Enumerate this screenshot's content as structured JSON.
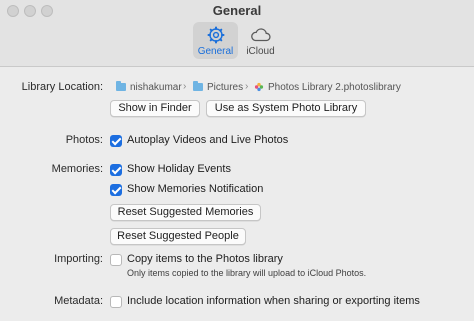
{
  "window": {
    "title": "General"
  },
  "tabs": [
    {
      "label": "General",
      "icon": "gear-icon",
      "selected": true
    },
    {
      "label": "iCloud",
      "icon": "cloud-icon",
      "selected": false
    }
  ],
  "library": {
    "label": "Library Location:",
    "path": [
      "nishakumar",
      "Pictures",
      "Photos Library 2.photoslibrary"
    ],
    "show_in_finder": "Show in Finder",
    "use_as_system": "Use as System Photo Library"
  },
  "photos": {
    "label": "Photos:",
    "autoplay": {
      "text": "Autoplay Videos and Live Photos",
      "checked": true
    }
  },
  "memories": {
    "label": "Memories:",
    "holiday": {
      "text": "Show Holiday Events",
      "checked": true
    },
    "notification": {
      "text": "Show Memories Notification",
      "checked": true
    },
    "reset_memories": "Reset Suggested Memories",
    "reset_people": "Reset Suggested People"
  },
  "importing": {
    "label": "Importing:",
    "copy": {
      "text": "Copy items to the Photos library",
      "checked": false
    },
    "note": "Only items copied to the library will upload to iCloud Photos."
  },
  "metadata": {
    "label": "Metadata:",
    "location": {
      "text": "Include location information when sharing or exporting items",
      "checked": false
    }
  },
  "colors": {
    "accent": "#1c6ee0",
    "tab_selected_text": "#1a6fdb"
  }
}
